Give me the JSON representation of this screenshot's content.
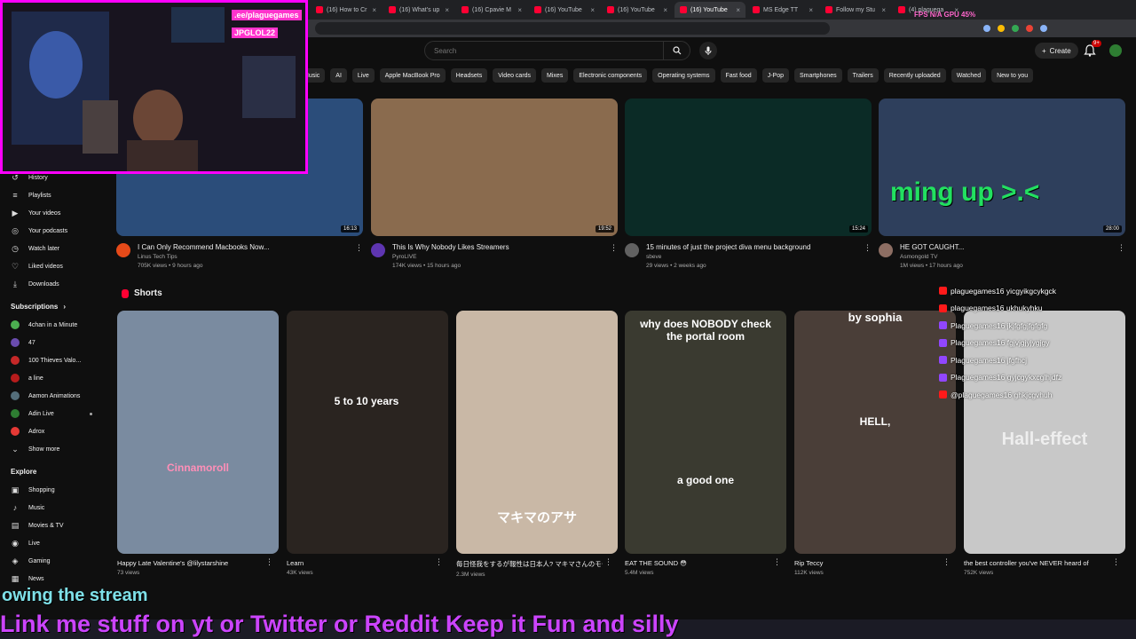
{
  "browser": {
    "tabs": [
      {
        "label": "(16) How to Cr"
      },
      {
        "label": "(16) What's up"
      },
      {
        "label": "(16) Cpavie M"
      },
      {
        "label": "(16) YouTube"
      },
      {
        "label": "(16) YouTube"
      },
      {
        "label": "(16) YouTube",
        "active": true
      },
      {
        "label": "MS Edge TT"
      },
      {
        "label": "Follow my Stu"
      },
      {
        "label": "(4) plaguega"
      }
    ],
    "fps_overlay": "FPS N/A  GPU 45%"
  },
  "header": {
    "search_placeholder": "Search",
    "create_label": "Create",
    "notification_count": "9+"
  },
  "chips": [
    "Music",
    "AI",
    "Live",
    "Apple MacBook Pro",
    "Headsets",
    "Video cards",
    "Mixes",
    "Electronic components",
    "Operating systems",
    "Fast food",
    "J-Pop",
    "Smartphones",
    "Trailers",
    "Recently uploaded",
    "Watched",
    "New to you"
  ],
  "sidebar": {
    "you_items": [
      {
        "label": "History",
        "icon": "history-icon",
        "glyph": "↺"
      },
      {
        "label": "Playlists",
        "icon": "playlist-icon",
        "glyph": "≡"
      },
      {
        "label": "Your videos",
        "icon": "your-videos-icon",
        "glyph": "▶"
      },
      {
        "label": "Your podcasts",
        "icon": "podcast-icon",
        "glyph": "◎"
      },
      {
        "label": "Watch later",
        "icon": "clock-icon",
        "glyph": "◷"
      },
      {
        "label": "Liked videos",
        "icon": "thumbs-up-icon",
        "glyph": "♡"
      },
      {
        "label": "Downloads",
        "icon": "download-icon",
        "glyph": "⤓"
      }
    ],
    "subscriptions_title": "Subscriptions",
    "subscriptions": [
      {
        "label": "4chan in a Minute",
        "color": "#4caf50",
        "dot": false
      },
      {
        "label": "47",
        "color": "#6a4cae",
        "dot": false
      },
      {
        "label": "100 Thieves Valo...",
        "color": "#c62828",
        "dot": false
      },
      {
        "label": "a line",
        "color": "#b71c1c",
        "dot": false
      },
      {
        "label": "Aamon Animations",
        "color": "#546e7a",
        "dot": false
      },
      {
        "label": "Adin Live",
        "color": "#2e7d32",
        "dot": true
      },
      {
        "label": "Adrox",
        "color": "#e53935",
        "dot": false
      }
    ],
    "show_more": "Show more",
    "explore_title": "Explore",
    "explore": [
      {
        "label": "Shopping",
        "icon": "shopping-bag-icon",
        "glyph": "▣"
      },
      {
        "label": "Music",
        "icon": "music-icon",
        "glyph": "♪"
      },
      {
        "label": "Movies & TV",
        "icon": "film-icon",
        "glyph": "▤"
      },
      {
        "label": "Live",
        "icon": "live-icon",
        "glyph": "◉"
      },
      {
        "label": "Gaming",
        "icon": "gaming-icon",
        "glyph": "◈"
      },
      {
        "label": "News",
        "icon": "news-icon",
        "glyph": "▦"
      }
    ]
  },
  "videos": [
    {
      "title": "I Can Only Recommend Macbooks Now...",
      "channel": "Linus Tech Tips",
      "stats": "705K views • 9 hours ago",
      "duration": "16:13",
      "avatar_color": "#e64a19",
      "thumb_bg": "#2b4d7a"
    },
    {
      "title": "This Is Why Nobody Likes Streamers",
      "channel": "PyroLIVE",
      "stats": "174K views • 15 hours ago",
      "duration": "19:52",
      "avatar_color": "#5e35b1",
      "thumb_bg": "#8a6b4e"
    },
    {
      "title": "15 minutes of just the project diva menu background",
      "channel": "sbeve",
      "stats": "29 views • 2 weeks ago",
      "duration": "15:24",
      "avatar_color": "#616161",
      "thumb_bg": "#0b2b26"
    },
    {
      "title": "HE GOT CAUGHT...",
      "channel": "Asmongold TV",
      "stats": "1M views • 17 hours ago",
      "duration": "28:00",
      "avatar_color": "#8d6e63",
      "thumb_bg": "#2e3f5c"
    }
  ],
  "shorts_title": "Shorts",
  "shorts": [
    {
      "title": "Happy Late Valentine's @lilystarshine",
      "views": "73 views",
      "overlay": "Cinnamoroll",
      "thumb_bg": "#7a8ba0"
    },
    {
      "title": "Learn",
      "views": "43K views",
      "overlay": "5 to 10 years",
      "thumb_bg": "#2a2420"
    },
    {
      "title": "毎日怪我をするが報性は日本人? マキマさんのモーニングルーティーン #チェンソーマン #...",
      "views": "2.3M views",
      "overlay": "マキマのアサ",
      "thumb_bg": "#c9b8a6"
    },
    {
      "title": "EAT THE SOUND 😳",
      "views": "5.4M views",
      "overlay": "why does NOBODY check the portal room",
      "overlay2": "a good one",
      "thumb_bg": "#3a3a30"
    },
    {
      "title": "Rip Teccy",
      "views": "112K views",
      "overlay": "by sophia",
      "overlay2": "HELL,",
      "thumb_bg": "#4a3e38"
    },
    {
      "title": "the best controller you've NEVER heard of",
      "views": "752K views",
      "overlay": "Hall-effect",
      "thumb_bg": "#c8c8c8"
    }
  ],
  "webcam": {
    "label1": ".ee/plaguegames",
    "label2": "JPGLOL22"
  },
  "chat": [
    {
      "text": "plaguegames16  yicgyikgcykgck",
      "icon_color": "#ff1a1a"
    },
    {
      "text": "plaguegames16  ukhukyhku",
      "icon_color": "#ff1a1a"
    },
    {
      "text": "Plaguegames16  jkjfgfgjfgfgfg",
      "icon_color": "#9146ff"
    },
    {
      "text": "Plaguegames16  fgjvjgjyjygjgy",
      "icon_color": "#9146ff"
    },
    {
      "text": "Plaguegames16  jfgfhcj",
      "icon_color": "#9146ff"
    },
    {
      "text": "Plaguegames16  gyjcgykxcglhjdfz",
      "icon_color": "#9146ff"
    },
    {
      "text": "@plaguegames16  ghkjcgvhuh",
      "icon_color": "#ff1a1a"
    }
  ],
  "thumb_overlay_text": "ming up >.<",
  "stream_overlay": "owing the stream",
  "ticker": "Link me stuff on yt or Twitter or Reddit  Keep it Fun and silly"
}
